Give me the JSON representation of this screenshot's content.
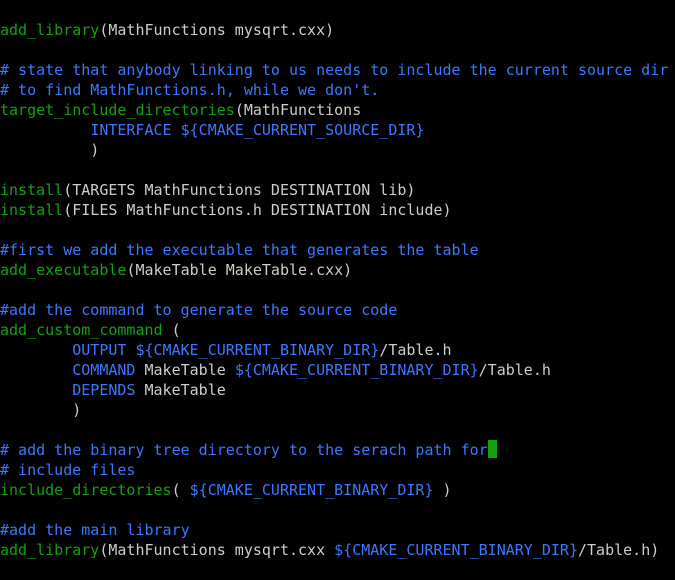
{
  "colors": {
    "background": "#000000",
    "command": "#13a10e",
    "plain": "#cccccc",
    "comment": "#3b78ff",
    "keyword": "#3b78ff",
    "variable": "#3b78ff",
    "cursor": "#13a10e"
  },
  "lines": [
    [
      {
        "t": "cmd",
        "s": "add_library"
      },
      {
        "t": "plain",
        "s": "(MathFunctions mysqrt.cxx)"
      }
    ],
    [],
    [
      {
        "t": "comment",
        "s": "# state that anybody linking to us needs to include the current source dir"
      }
    ],
    [
      {
        "t": "comment",
        "s": "# to find MathFunctions.h, while we don't."
      }
    ],
    [
      {
        "t": "cmd",
        "s": "target_include_directories"
      },
      {
        "t": "plain",
        "s": "(MathFunctions"
      }
    ],
    [
      {
        "t": "plain",
        "s": "          "
      },
      {
        "t": "kw",
        "s": "INTERFACE"
      },
      {
        "t": "plain",
        "s": " "
      },
      {
        "t": "var",
        "s": "${CMAKE_CURRENT_SOURCE_DIR}"
      }
    ],
    [
      {
        "t": "plain",
        "s": "          )"
      }
    ],
    [],
    [
      {
        "t": "cmd",
        "s": "install"
      },
      {
        "t": "plain",
        "s": "(TARGETS MathFunctions DESTINATION lib)"
      }
    ],
    [
      {
        "t": "cmd",
        "s": "install"
      },
      {
        "t": "plain",
        "s": "(FILES MathFunctions.h DESTINATION include)"
      }
    ],
    [],
    [
      {
        "t": "comment",
        "s": "#first we add the executable that generates the table"
      }
    ],
    [
      {
        "t": "cmd",
        "s": "add_executable"
      },
      {
        "t": "plain",
        "s": "(MakeTable MakeTable.cxx)"
      }
    ],
    [],
    [
      {
        "t": "comment",
        "s": "#add the command to generate the source code"
      }
    ],
    [
      {
        "t": "cmd",
        "s": "add_custom_command"
      },
      {
        "t": "plain",
        "s": " ("
      }
    ],
    [
      {
        "t": "plain",
        "s": "        "
      },
      {
        "t": "kw",
        "s": "OUTPUT"
      },
      {
        "t": "plain",
        "s": " "
      },
      {
        "t": "var",
        "s": "${CMAKE_CURRENT_BINARY_DIR}"
      },
      {
        "t": "plain",
        "s": "/Table.h"
      }
    ],
    [
      {
        "t": "plain",
        "s": "        "
      },
      {
        "t": "kw",
        "s": "COMMAND"
      },
      {
        "t": "plain",
        "s": " MakeTable "
      },
      {
        "t": "var",
        "s": "${CMAKE_CURRENT_BINARY_DIR}"
      },
      {
        "t": "plain",
        "s": "/Table.h"
      }
    ],
    [
      {
        "t": "plain",
        "s": "        "
      },
      {
        "t": "kw",
        "s": "DEPENDS"
      },
      {
        "t": "plain",
        "s": " MakeTable"
      }
    ],
    [
      {
        "t": "plain",
        "s": "        )"
      }
    ],
    [],
    [
      {
        "t": "comment",
        "s": "# add the binary tree directory to the serach path for"
      },
      {
        "t": "cursor",
        "s": ""
      }
    ],
    [
      {
        "t": "comment",
        "s": "# include files"
      }
    ],
    [
      {
        "t": "cmd",
        "s": "include_directories"
      },
      {
        "t": "plain",
        "s": "( "
      },
      {
        "t": "var",
        "s": "${CMAKE_CURRENT_BINARY_DIR}"
      },
      {
        "t": "plain",
        "s": " )"
      }
    ],
    [],
    [
      {
        "t": "comment",
        "s": "#add the main library"
      }
    ],
    [
      {
        "t": "cmd",
        "s": "add_library"
      },
      {
        "t": "plain",
        "s": "(MathFunctions mysqrt.cxx "
      },
      {
        "t": "var",
        "s": "${CMAKE_CURRENT_BINARY_DIR}"
      },
      {
        "t": "plain",
        "s": "/Table.h)"
      }
    ]
  ]
}
